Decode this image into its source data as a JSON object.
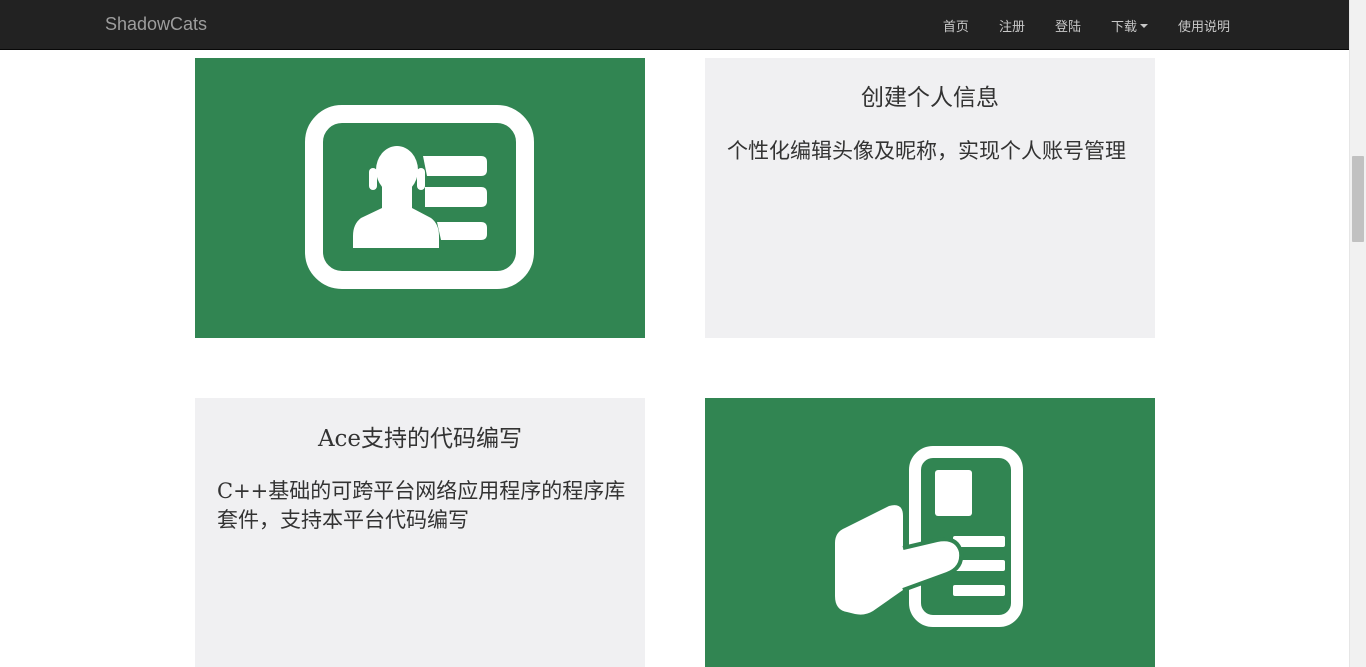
{
  "navbar": {
    "brand": "ShadowCats",
    "items": [
      {
        "label": "首页"
      },
      {
        "label": "注册"
      },
      {
        "label": "登陆"
      },
      {
        "label": "下载",
        "dropdown": true
      },
      {
        "label": "使用说明"
      }
    ]
  },
  "features": [
    {
      "title": "创建个人信息",
      "description": "个性化编辑头像及昵称，实现个人账号管理",
      "icon": "id-card-icon"
    },
    {
      "title": "Ace支持的代码编写",
      "description": "C++基础的可跨平台网络应用程序的程序库套件，支持本平台代码编写",
      "icon": "hand-holding-card-icon"
    }
  ],
  "colors": {
    "navbar_bg": "#222222",
    "accent_green": "#318552",
    "panel_gray": "#f0f0f2"
  }
}
